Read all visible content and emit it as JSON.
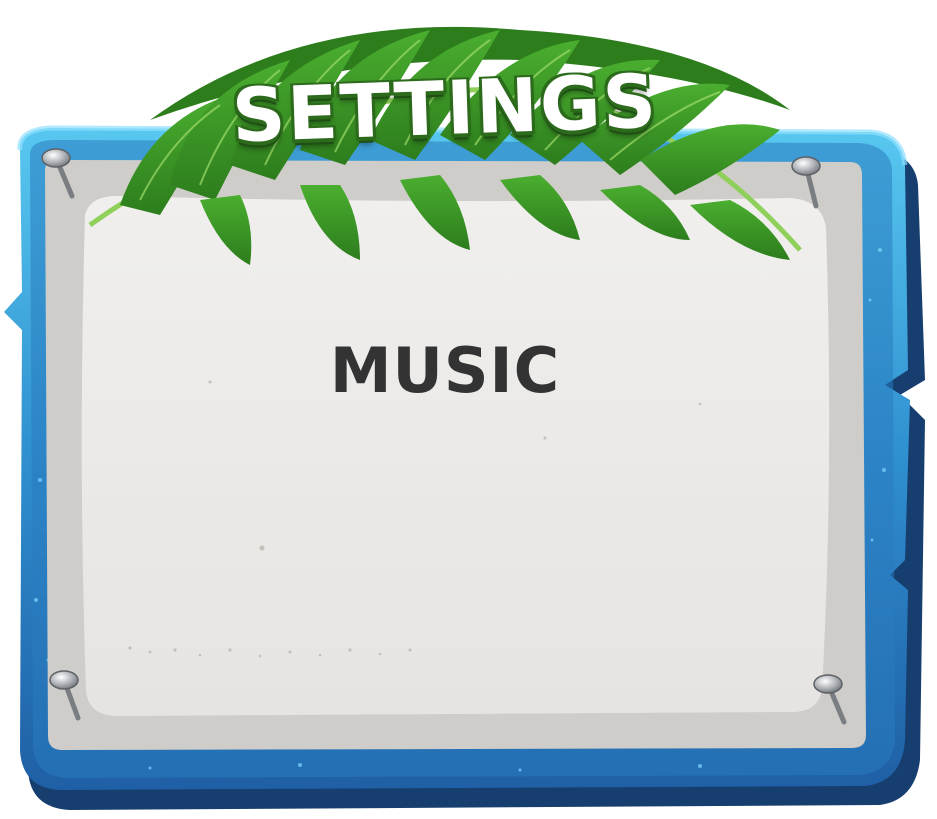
{
  "panel": {
    "title": "SETTINGS",
    "sections": [
      {
        "label": "MUSIC"
      }
    ]
  },
  "colors": {
    "frame_blue": "#2f8fcf",
    "frame_dark": "#1c4f8a",
    "paper": "#ebe9e6",
    "leaf_green": "#3f9a2a",
    "text_dark": "#333333"
  },
  "icons": [
    "nail-icon",
    "palm-leaf-decoration"
  ]
}
